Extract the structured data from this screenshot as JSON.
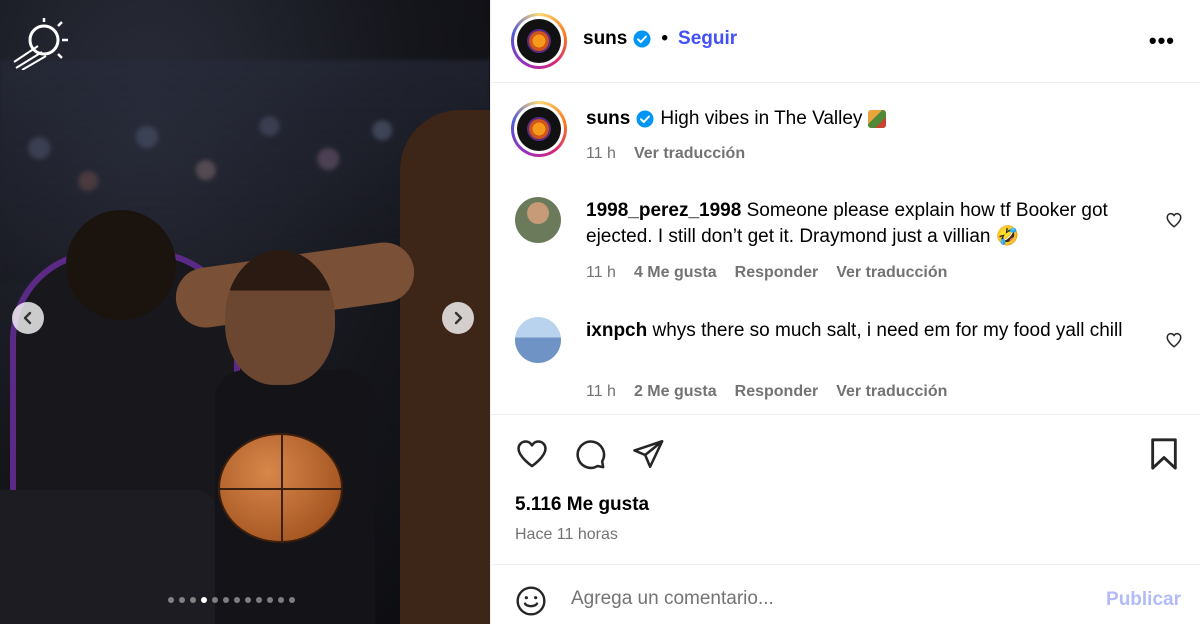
{
  "media": {
    "carousel_dot_count": 12,
    "active_dot_index": 3
  },
  "header": {
    "username": "suns",
    "separator": "•",
    "follow_label": "Seguir",
    "more_label": "•••"
  },
  "post": {
    "username": "suns",
    "caption": "High vibes in The Valley",
    "time": "11 h",
    "translate_label": "Ver traducción"
  },
  "comments": [
    {
      "username": "1998_perez_1998",
      "text": "Someone please explain how tf Booker got ejected. I still don’t get it. Draymond just a villian 🤣",
      "time": "11 h",
      "likes": "4 Me gusta",
      "reply_label": "Responder",
      "translate_label": "Ver traducción"
    },
    {
      "username": "ixnpch",
      "text": "whys there so much salt, i need em for my food yall chill",
      "time": "11 h",
      "likes": "2 Me gusta",
      "reply_label": "Responder",
      "translate_label": "Ver traducción"
    }
  ],
  "stats": {
    "likes": "5.116 Me gusta",
    "posted": "Hace 11 horas"
  },
  "comment_bar": {
    "placeholder": "Agrega un comentario...",
    "publish_label": "Publicar"
  },
  "colors": {
    "link_blue": "#4150f7",
    "publish_disabled": "#b2bbf7",
    "meta_gray": "#737373",
    "verified_blue": "#0095f6"
  }
}
